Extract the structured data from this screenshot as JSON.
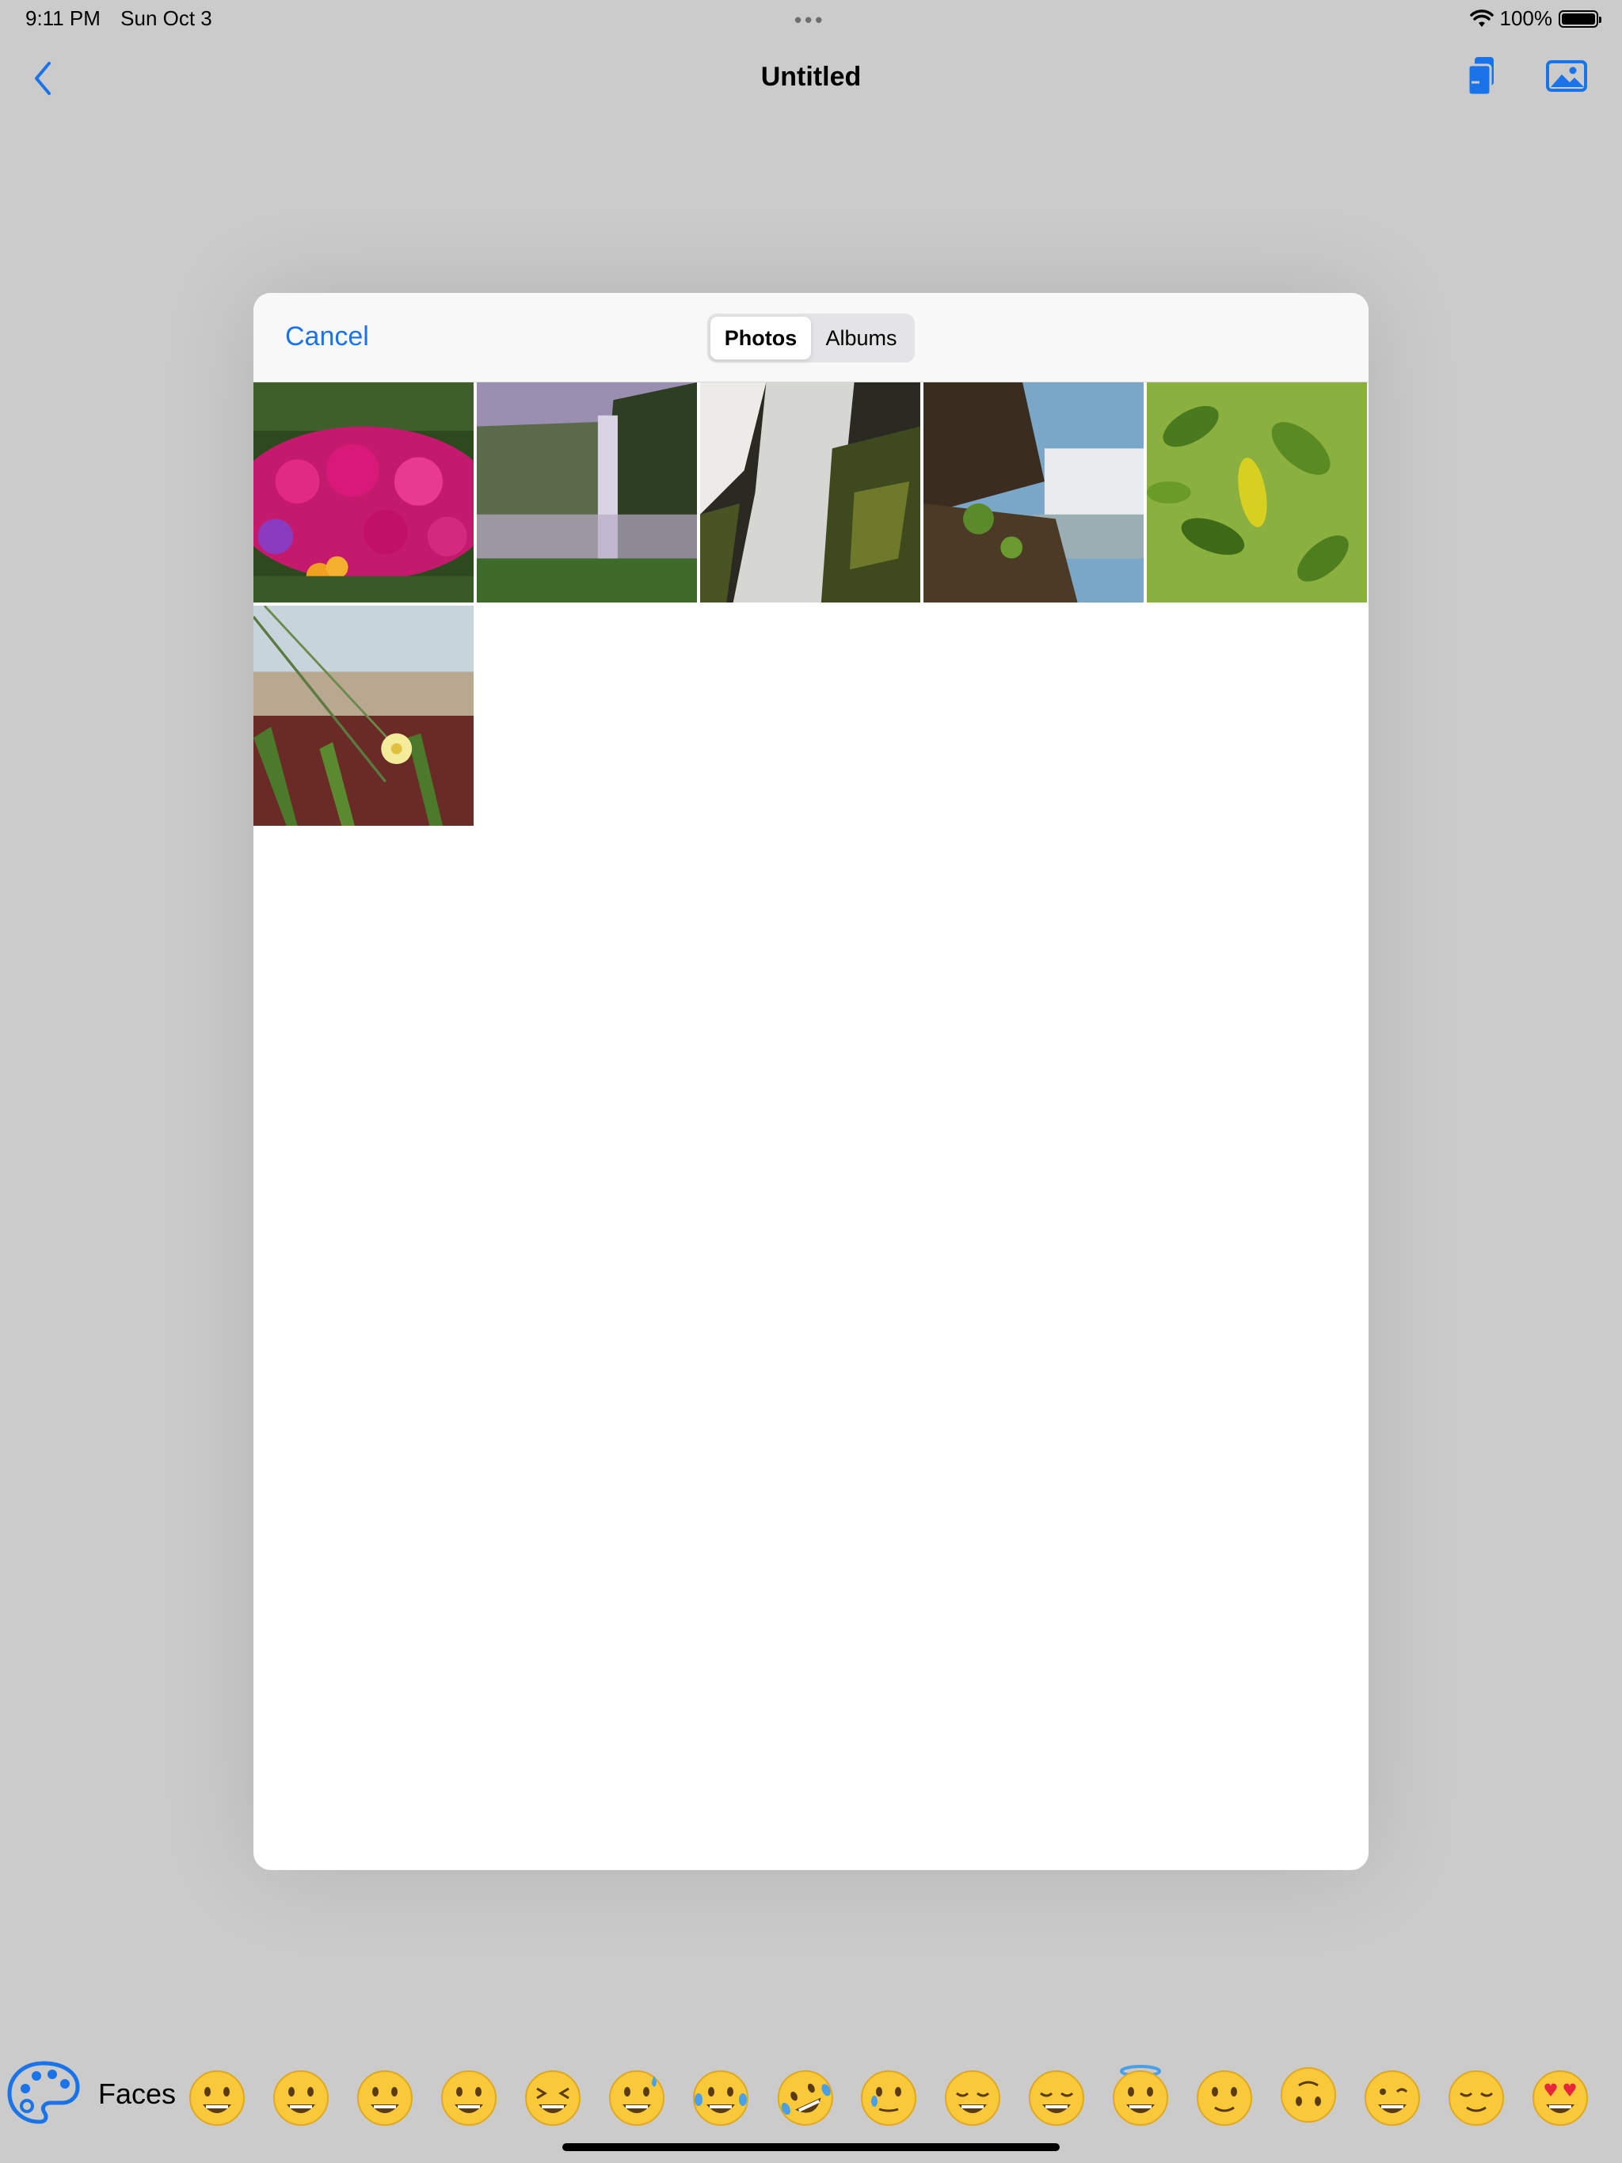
{
  "status": {
    "time": "9:11 PM",
    "date": "Sun Oct 3",
    "battery": "100%",
    "battery_level": 1.0
  },
  "nav": {
    "title": "Untitled"
  },
  "picker": {
    "cancel_label": "Cancel",
    "tabs": [
      {
        "label": "Photos",
        "active": true
      },
      {
        "label": "Albums",
        "active": false
      }
    ],
    "photos": [
      {
        "name": "pink-flowers"
      },
      {
        "name": "misty-waterfall"
      },
      {
        "name": "waterfall-rocks"
      },
      {
        "name": "waterfall-cliff"
      },
      {
        "name": "green-leaves"
      },
      {
        "name": "dune-flower"
      }
    ]
  },
  "emoji_bar": {
    "category": "Faces",
    "emojis": [
      "grin",
      "smile",
      "grin-eyes",
      "beam",
      "laugh-squint",
      "sweat",
      "tears",
      "rofl",
      "cry-smile",
      "blush-relaxed",
      "smile-eyes",
      "halo",
      "slight",
      "upside",
      "wink",
      "relieved",
      "heart-eyes"
    ]
  },
  "colors": {
    "accent": "#1a73e8",
    "background": "#cbcbcb"
  }
}
